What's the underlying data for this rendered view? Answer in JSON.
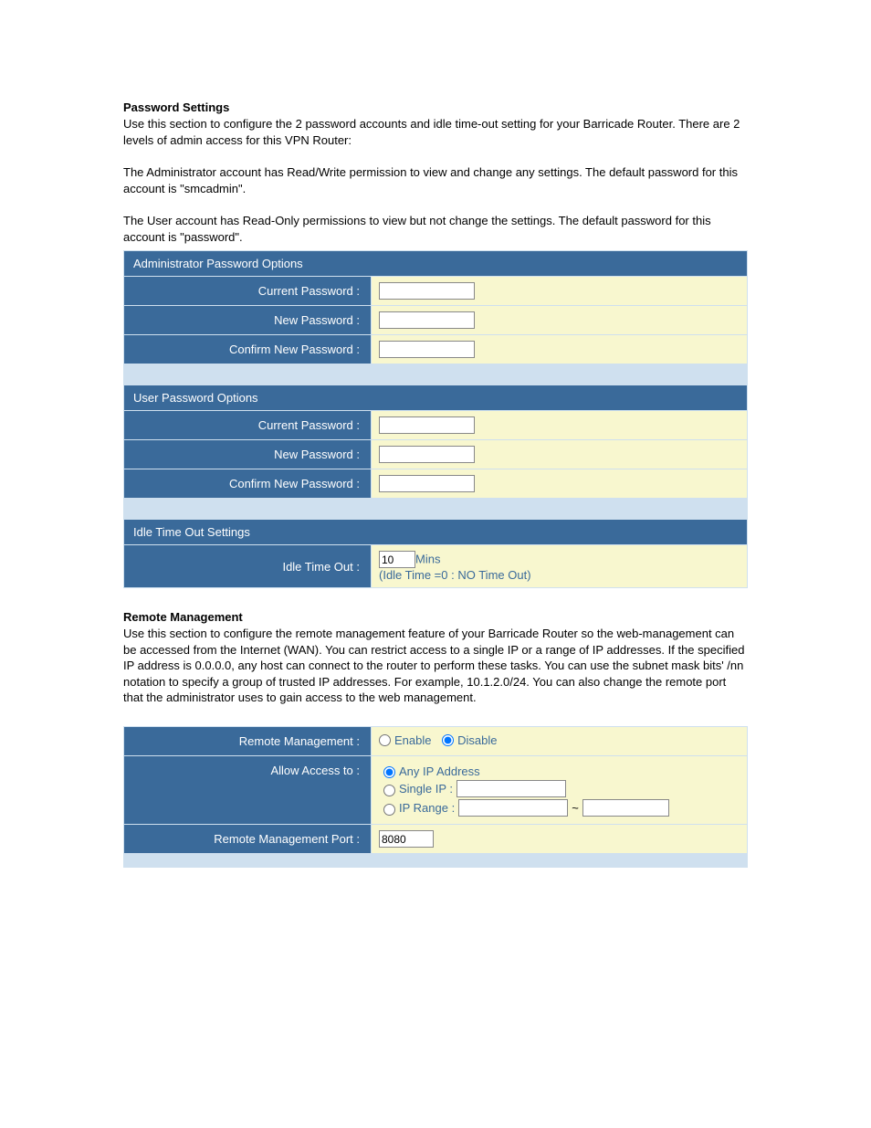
{
  "password_settings": {
    "heading": "Password Settings",
    "intro": "Use this section to configure the 2 password accounts and idle time-out setting for your Barricade Router. There are 2 levels of admin access for this VPN Router:",
    "admin_desc": "The Administrator account has Read/Write permission to view and change any settings. The default password for this account is \"smcadmin\".",
    "user_desc": "The User account has Read-Only permissions to view but not change the settings. The default password for this account is \"password\".",
    "admin_header": "Administrator Password Options",
    "user_header": "User Password Options",
    "idle_header": "Idle Time Out Settings",
    "labels": {
      "current_pw": "Current Password :",
      "new_pw": "New Password :",
      "confirm_pw": "Confirm New Password :",
      "idle_timeout": "Idle Time Out :"
    },
    "idle_value": "10",
    "idle_unit": "Mins",
    "idle_hint": "(Idle Time =0 : NO Time Out)"
  },
  "remote_mgmt": {
    "heading": "Remote Management",
    "intro": "Use this section to configure the remote management feature of your Barricade Router so the web-management can be accessed from the Internet (WAN). You can restrict access to a single IP or a range of IP addresses. If the specified IP address is 0.0.0.0, any host can connect to the router to perform these tasks. You can use the subnet mask bits' /nn notation to specify a group of trusted IP addresses. For example, 10.1.2.0/24. You can also change the remote port that the administrator uses to gain access to the web management.",
    "labels": {
      "remote_mgmt": "Remote Management :",
      "allow_access": "Allow Access to :",
      "remote_port": "Remote Management Port :"
    },
    "options": {
      "enable": "Enable",
      "disable": "Disable",
      "any_ip": "Any IP Address",
      "single_ip": "Single IP :",
      "ip_range": "IP Range :"
    },
    "port_value": "8080",
    "tilde": "~"
  }
}
